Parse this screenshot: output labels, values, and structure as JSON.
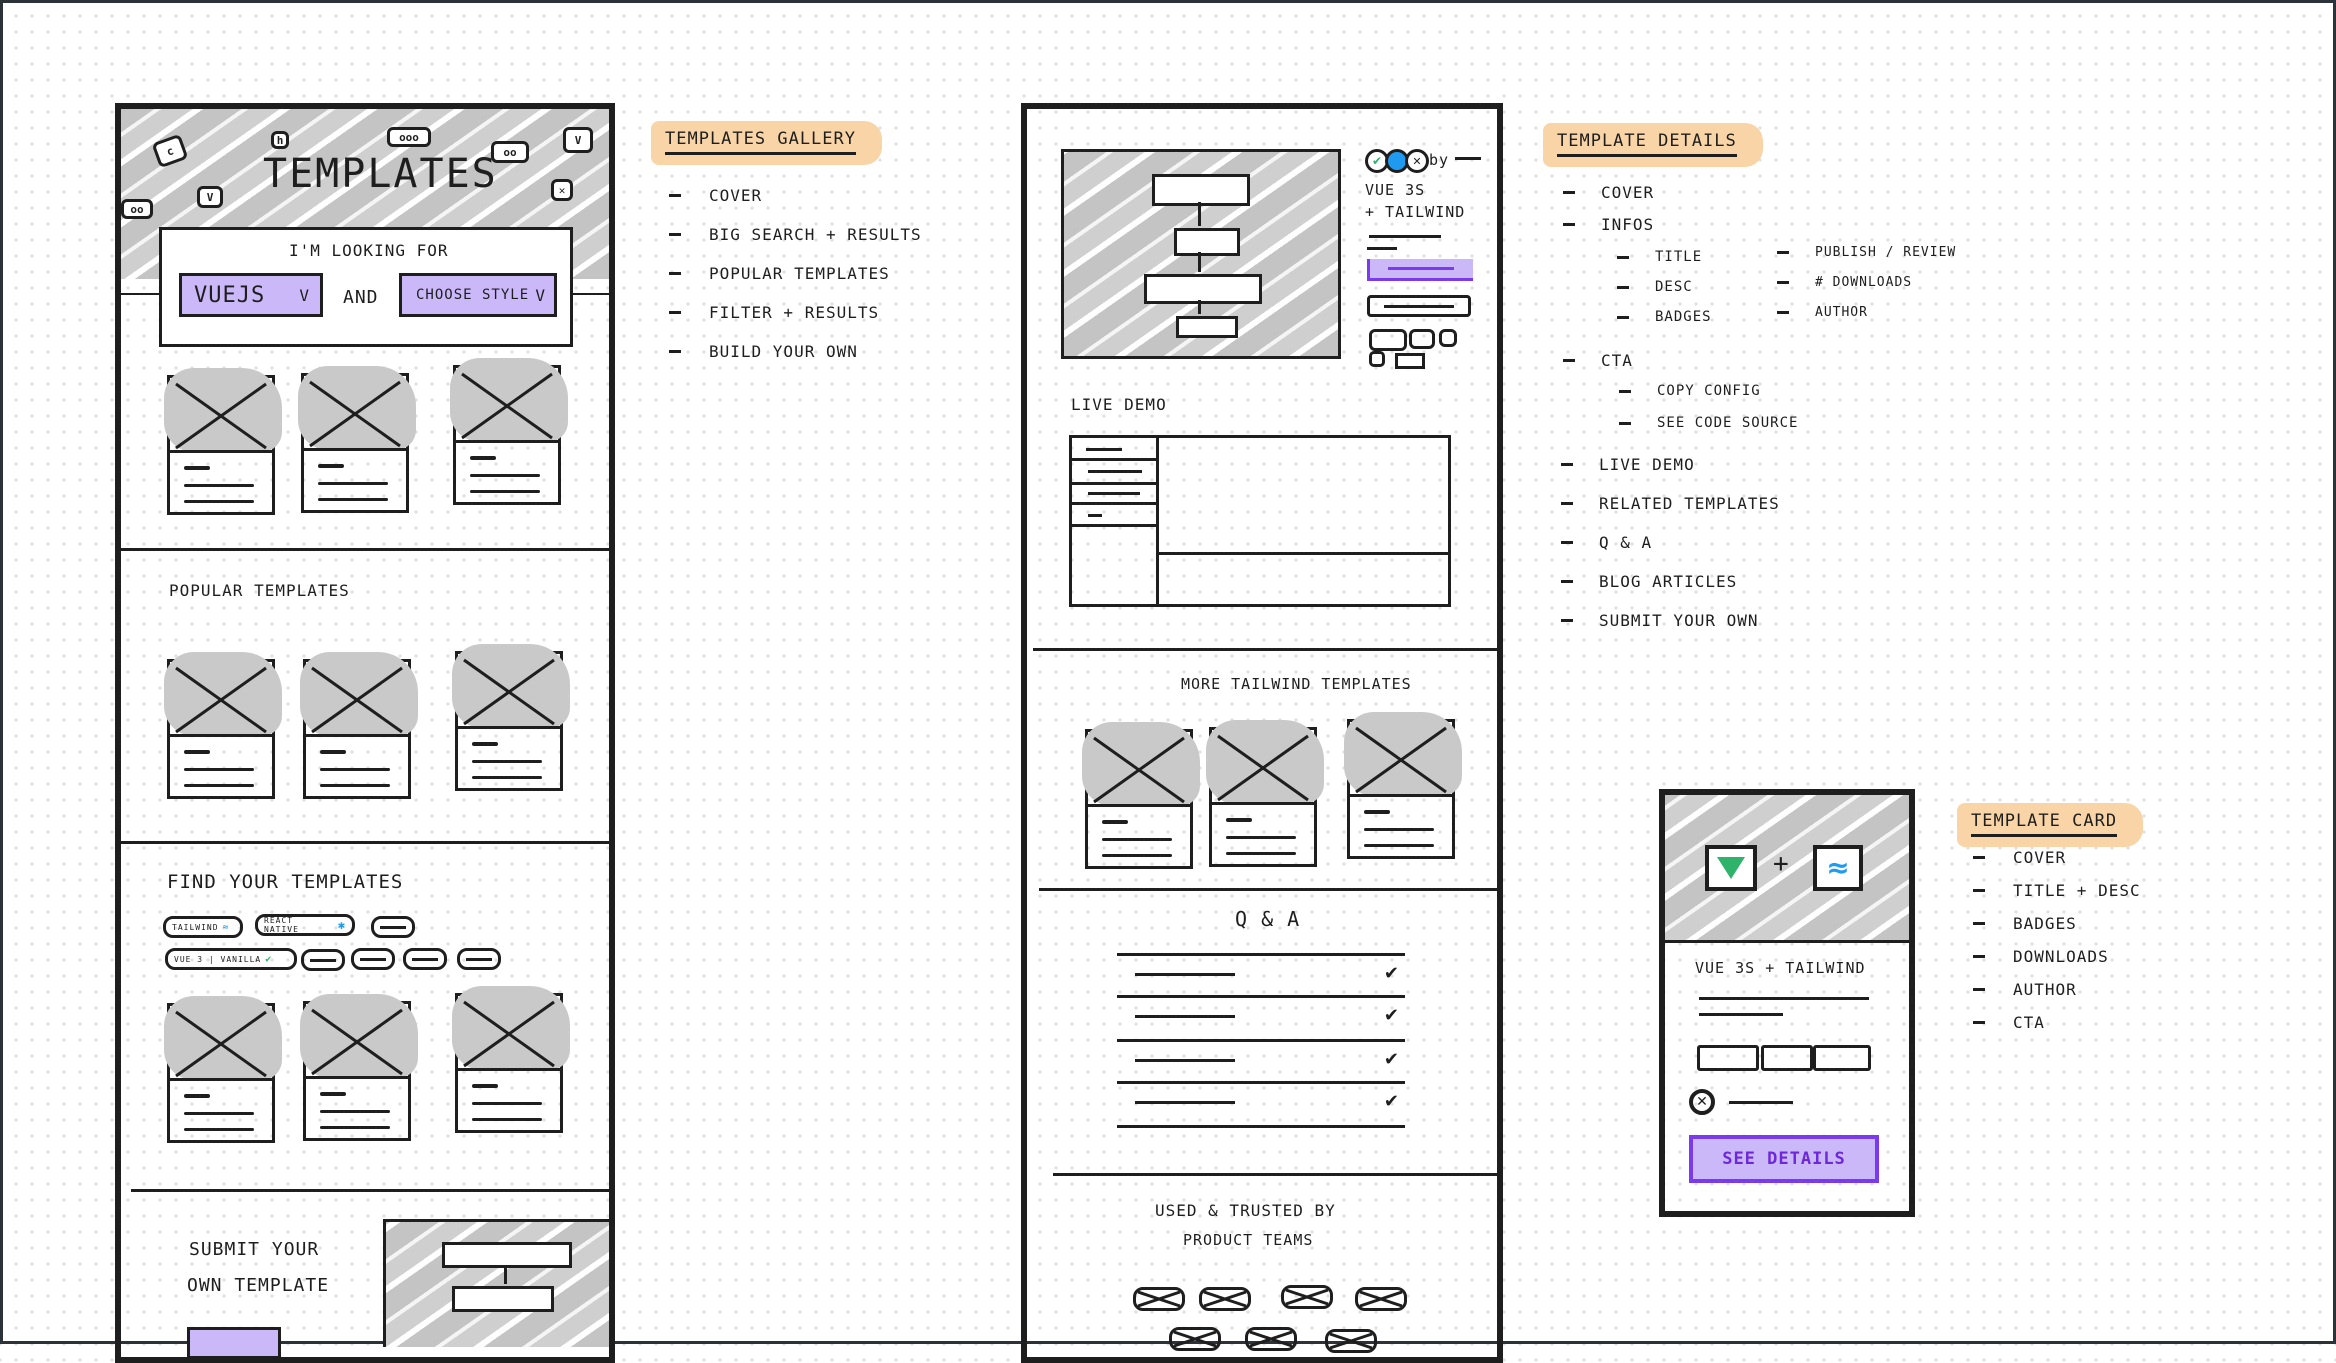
{
  "canvas": {
    "colors": {
      "stroke": "#1e1e1e",
      "hatch": "#c4c4c4",
      "label_highlight": "#f9d4a6",
      "purple_fill": "#cbb8f9",
      "purple_stroke": "#7c3aed",
      "vue_green": "#2fb36b",
      "tailwind_blue": "#1e9bf0",
      "frame_border": "#2b3238"
    }
  },
  "gallery_wireframe": {
    "hero": {
      "title": "Templates",
      "icons": [
        "css",
        "h",
        "ooo",
        "oo",
        "v",
        "v",
        "oo",
        "x"
      ],
      "search_label": "I'm looking for",
      "framework_select": "VueJS",
      "connector": "and",
      "style_select": "Choose style"
    },
    "popular_title": "Popular templates",
    "find_title": "Find your templates",
    "filter_chips_row1": [
      "Tailwind",
      "React Native",
      ""
    ],
    "filter_chips_row2": [
      "Vue 3 | Vanilla",
      "",
      "",
      "",
      ""
    ],
    "submit": {
      "title_line1": "Submit your",
      "title_line2": "own template"
    }
  },
  "gallery_notes": {
    "heading": "Templates gallery",
    "items": [
      "Cover",
      "Big search + results",
      "Popular templates",
      "Filter + results",
      "Build your own"
    ]
  },
  "details_wireframe": {
    "by_label": "by",
    "title_line1": "Vue 3S",
    "title_line2": "+ Tailwind",
    "live_demo_label": "Live demo",
    "more_title": "More Tailwind templates",
    "qa_title": "Q & A",
    "trusted_line1": "Used & trusted by",
    "trusted_line2": "product teams"
  },
  "details_notes": {
    "heading": "Template details",
    "items": [
      {
        "label": "Cover",
        "level": 0
      },
      {
        "label": "Infos",
        "level": 0
      },
      {
        "label": "CTA",
        "level": 0
      },
      {
        "label": "Copy config",
        "level": 1
      },
      {
        "label": "See code source",
        "level": 1
      },
      {
        "label": "Live demo",
        "level": 0
      },
      {
        "label": "Related templates",
        "level": 0
      },
      {
        "label": "Q & A",
        "level": 0
      },
      {
        "label": "Blog articles",
        "level": 0
      },
      {
        "label": "Submit your own",
        "level": 0
      }
    ],
    "infos_col1": [
      "Title",
      "Desc",
      "Badges"
    ],
    "infos_col2": [
      "Publish / Review",
      "# Downloads",
      "Author"
    ]
  },
  "card_wireframe": {
    "plus": "+",
    "title": "Vue 3S + Tailwind",
    "cta": "See details"
  },
  "card_notes": {
    "heading": "Template card",
    "items": [
      "Cover",
      "Title + Desc",
      "Badges",
      "Downloads",
      "Author",
      "CTA"
    ]
  }
}
